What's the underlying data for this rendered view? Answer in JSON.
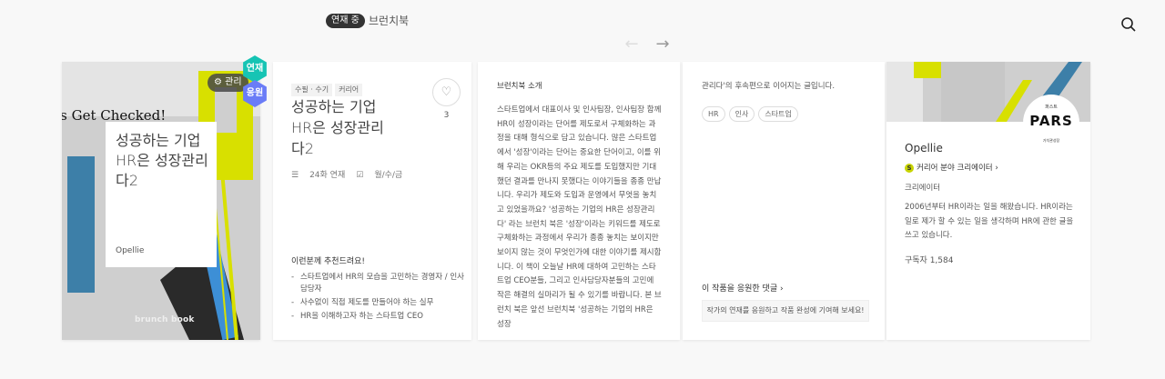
{
  "header": {
    "badge": "연재 중",
    "title": "브런치북"
  },
  "cover": {
    "manage_label": "관리",
    "title": "성공하는 기업HR은 성장관리다2",
    "author": "Opellie",
    "brand": "brunch book",
    "bg_text": "t's Get Checked!",
    "hex_serial": "연재",
    "hex_apply": "응원"
  },
  "info": {
    "tags": [
      "수필 · 수기",
      "커리어"
    ],
    "title": "성공하는 기업HR은 성장관리다2",
    "like_count": "3",
    "episodes": "24화 연재",
    "schedule": "월/수/금",
    "rec_head": "이런분께 추천드려요!",
    "rec_items": [
      "스타트업에서 HR의 모습을 고민하는 경영자 / 인사담당자",
      "사수없이 직접 제도를 만들어야 하는 실무",
      "HR을 이해하고자 하는 스타트업 CEO"
    ]
  },
  "intro": {
    "heading": "브런치북 소개",
    "body": "스타트업에서 대표이사 및 인사팀장, 인사팀장 함께 HR이 성장이라는 단어를 제도로서 구체화하는 과정을 대해 형식으로 담고 있습니다. 많은 스타트업에서 '성장'이라는 단어는 중요한 단어이고, 이를 위해 우리는 OKR등의 주요 제도를 도입했지만 기대했던 결과를 만나지 못했다는 이야기들을 종종 만납니다. 우리가 제도와 도입과 운영에서 무엇을 놓치고 있었을까요? '성공하는 기업의 HR은 성장관리다' 라는 브런치 북은 '성장'이라는 키워드를 제도로 구체화하는 과정에서 우리가 종종 놓치는 보이지만 보이지 않는 것이 무엇인가에 대한 이야기를 제시합니다. 이 책이 오늘날 HR에 대하여 고민하는 스타트업 CEO분들, 그리고 인사담당자분들의 고민에 작은 해결의 실마리가 될 수 있기를 바랍니다. 본 브런치 북은 앞선 브런치북 '성공하는 기업의 HR은 성장"
  },
  "more": {
    "text": "관리다'의 후속편으로 이어지는 글입니다.",
    "keywords": [
      "HR",
      "인사",
      "스타트업"
    ],
    "cheer_link": "이 작품을 응원한 댓글",
    "cheer_box": "작가의 연재를 응원하고 작품 완성에 기여해 보세요!"
  },
  "author": {
    "avatar_small": "퍼스트",
    "avatar_text": "PARS",
    "avatar_sub": "가치관성장",
    "name": "Opellie",
    "creator_mark": "S",
    "creator": "커리어 분야 크리에이터",
    "role": "크리에이터",
    "bio": "2006년부터 HR이라는 일을 해왔습니다. HR이라는 일로 제가 할 수 있는 일을 생각하며 HR에 관한 글을 쓰고 있습니다.",
    "subscribers": "구독자 1,584"
  },
  "colors": {
    "accent_teal": "#16c4b4",
    "accent_indigo": "#6a7cf7",
    "accent_lime": "#c8d400"
  }
}
